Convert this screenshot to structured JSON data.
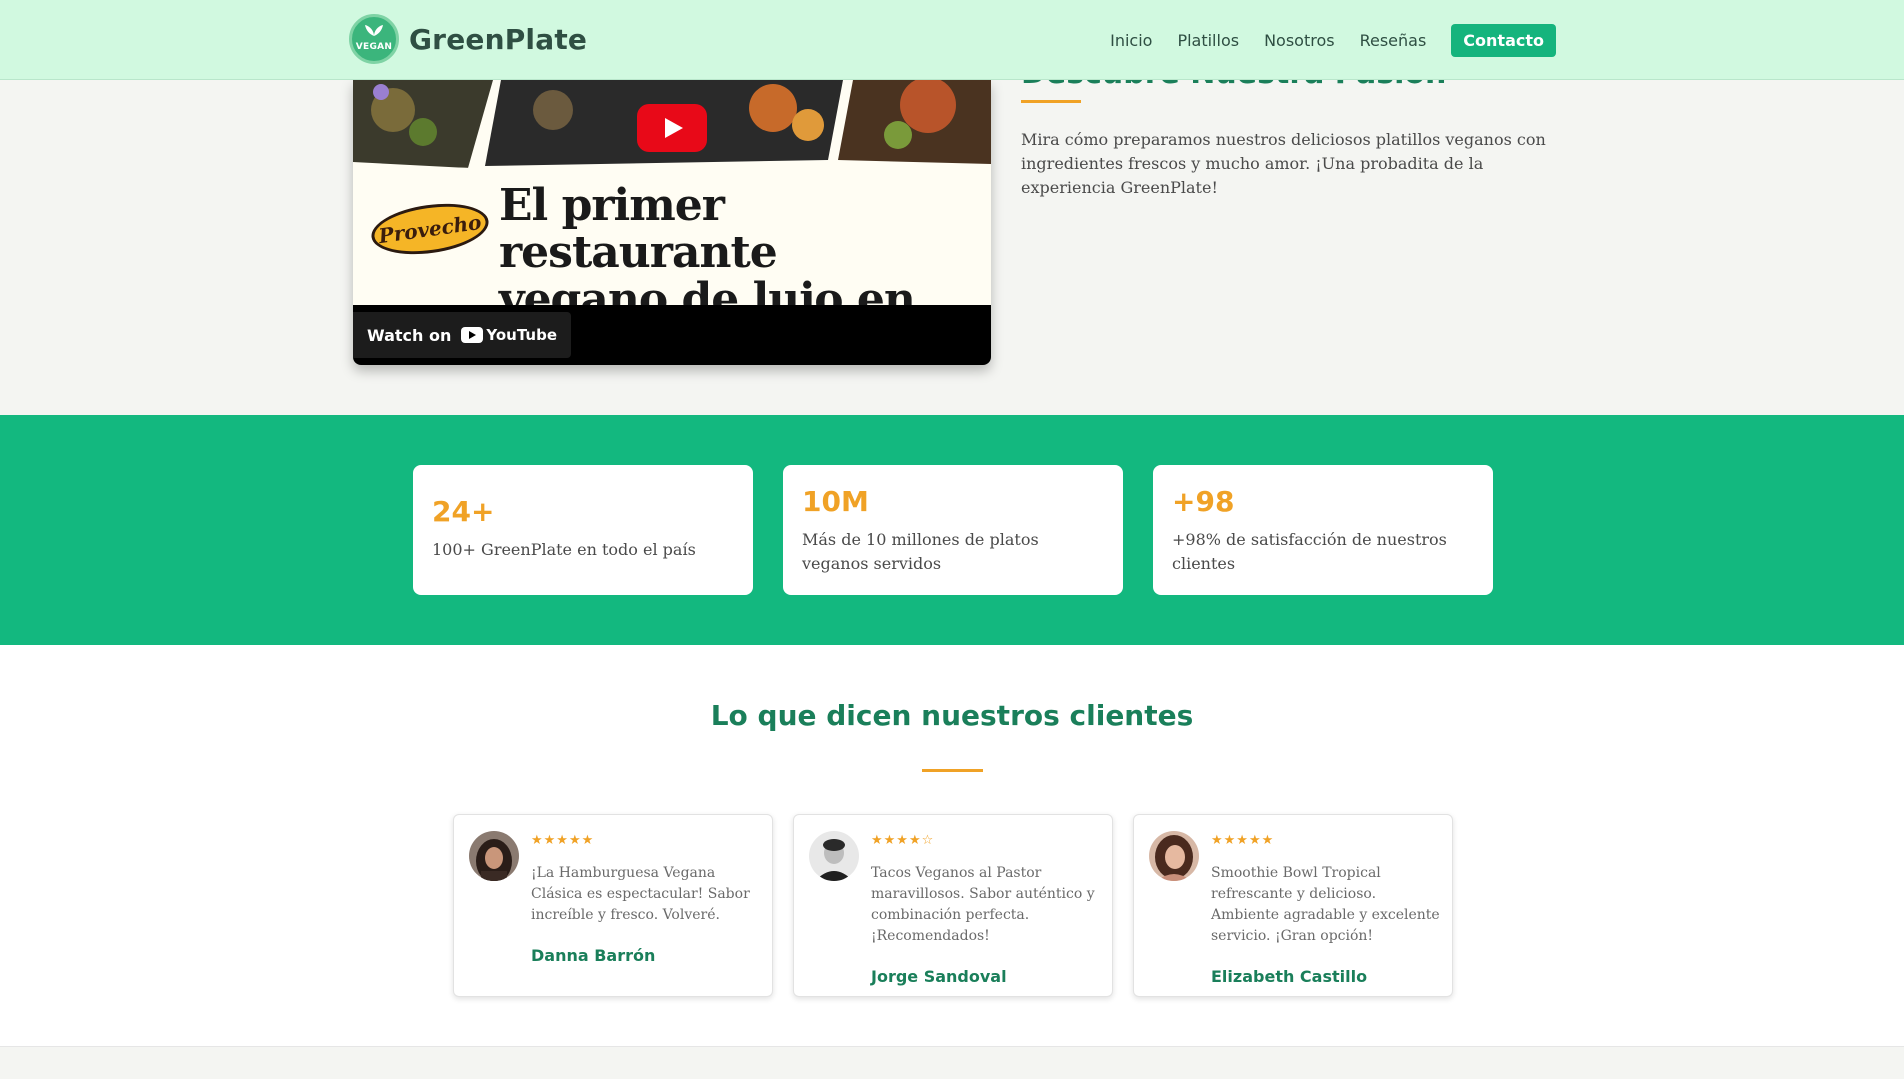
{
  "header": {
    "logo_text": "VEGAN",
    "brand": "GreenPlate",
    "nav": [
      "Inicio",
      "Platillos",
      "Nosotros",
      "Reseñas"
    ],
    "cta": "Contacto"
  },
  "video": {
    "logo_text": "Provecho",
    "title_line1": "El primer restaurante",
    "title_line2": "vegano de lujo en Perú",
    "watch_label": "Watch on",
    "youtube_label": "YouTube"
  },
  "about": {
    "title": "Descubre Nuestra Pasión",
    "description": "Mira cómo preparamos nuestros deliciosos platillos veganos con ingredientes frescos y mucho amor. ¡Una probadita de la experiencia GreenPlate!"
  },
  "stats": [
    {
      "number": "24+",
      "label": "100+ GreenPlate en todo el país"
    },
    {
      "number": "10M",
      "label": "Más de 10 millones de platos veganos servidos"
    },
    {
      "number": "+98",
      "label": "+98% de satisfacción de nuestros clientes"
    }
  ],
  "testimonials": {
    "title": "Lo que dicen nuestros clientes",
    "items": [
      {
        "stars": "★★★★★",
        "rating": 5,
        "quote": "¡La Hamburguesa Vegana Clásica es espectacular! Sabor increíble y fresco. Volveré.",
        "author": "Danna Barrón"
      },
      {
        "stars": "★★★★☆",
        "rating": 4,
        "quote": "Tacos Veganos al Pastor maravillosos. Sabor auténtico y combinación perfecta. ¡Recomendados!",
        "author": "Jorge Sandoval"
      },
      {
        "stars": "★★★★★",
        "rating": 5,
        "quote": "Smoothie Bowl Tropical refrescante y delicioso. Ambiente agradable y excelente servicio. ¡Gran opción!",
        "author": "Elizabeth Castillo"
      }
    ]
  },
  "colors": {
    "header_bg": "#d1f9e0",
    "brand_green": "#1a7f5a",
    "accent_green": "#13b87f",
    "accent_orange": "#f0a226"
  }
}
